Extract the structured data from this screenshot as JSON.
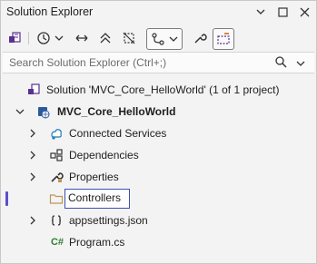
{
  "window": {
    "title": "Solution Explorer",
    "icons": [
      "chevron-down-icon",
      "maximize-icon",
      "close-icon"
    ]
  },
  "search": {
    "placeholder": "Search Solution Explorer (Ctrl+;)"
  },
  "tree": {
    "solution": "Solution 'MVC_Core_HelloWorld' (1 of 1 project)",
    "project": "MVC_Core_HelloWorld",
    "items": [
      {
        "label": "Connected Services",
        "icon": "connected-services-icon"
      },
      {
        "label": "Dependencies",
        "icon": "dependencies-icon"
      },
      {
        "label": "Properties",
        "icon": "properties-icon"
      },
      {
        "label": "Controllers",
        "icon": "folder-icon",
        "editing": true
      },
      {
        "label": "appsettings.json",
        "icon": "json-file-icon"
      },
      {
        "label": "Program.cs",
        "icon": "csharp-file-icon"
      }
    ],
    "csharp_glyph": "C#"
  },
  "colors": {
    "background": "#f3f3f3",
    "accent": "#3c4fb6",
    "project_icon": "#5b2f91",
    "folder": "#c09553",
    "csharp": "#2e7d32"
  }
}
